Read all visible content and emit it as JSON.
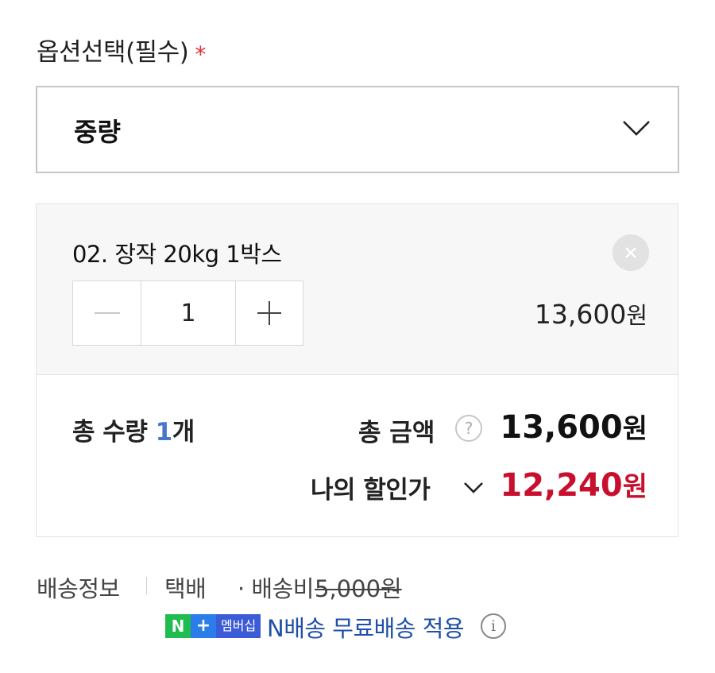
{
  "option": {
    "label": "옵션선택(필수)",
    "required_mark": "*",
    "selected": "중량"
  },
  "item": {
    "name": "02. 장작 20kg 1박스",
    "quantity": "1",
    "price": "13,600",
    "currency": "원"
  },
  "summary": {
    "total_qty_prefix": "총 수량 ",
    "total_qty_num": "1",
    "total_qty_unit": "개",
    "total_amount_label": "총 금액",
    "help_glyph": "?",
    "total_amount": "13,600",
    "currency": "원",
    "my_price_label": "나의 할인가",
    "my_price": "12,240"
  },
  "shipping": {
    "title": "배송정보",
    "method": "택배",
    "fee_label": "· 배송비",
    "fee": "5,000원",
    "badge_n": "N",
    "badge_plus": "+",
    "badge_member": "멤버십",
    "free_text": "N배송 무료배송 적용",
    "info_glyph": "i"
  },
  "colors": {
    "accent_red": "#c8102e",
    "qty_blue": "#4a78c8",
    "link_blue": "#1f4fa8",
    "badge_green": "#1fbd4f",
    "badge_blue": "#2b7de9"
  },
  "icons": [
    "chevron-down-icon",
    "close-icon",
    "minus-icon",
    "plus-icon",
    "question-circle-icon",
    "info-circle-icon"
  ]
}
